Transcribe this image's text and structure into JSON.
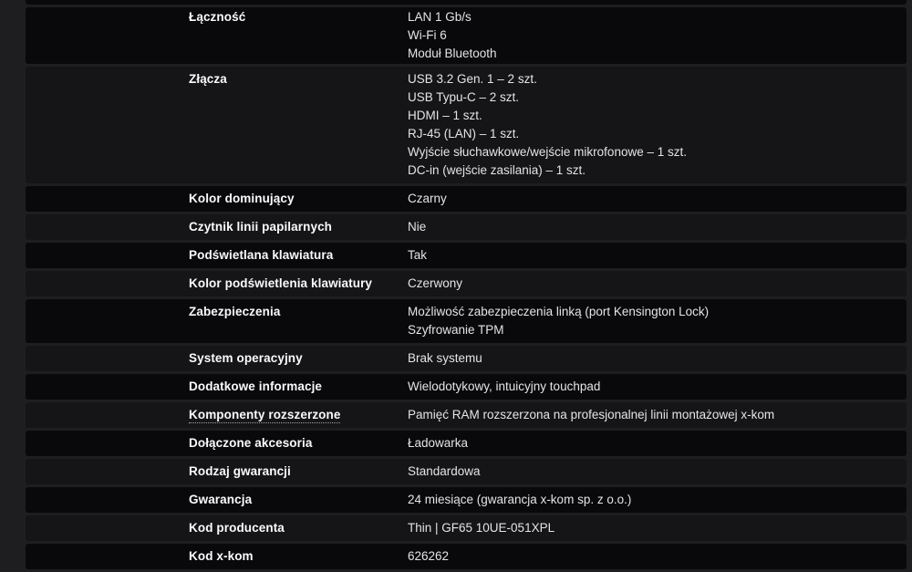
{
  "theme": {
    "page_background": "#1e1e20",
    "row_stripe_light": "#151517",
    "row_stripe_dark": "#09090b",
    "label_color": "#fafafa",
    "value_color": "#e4e4e6"
  },
  "table": {
    "rows": [
      {
        "label": "Łączność",
        "values": [
          "LAN 1 Gb/s",
          "Wi-Fi 6",
          "Moduł Bluetooth"
        ]
      },
      {
        "label": "Złącza",
        "values": [
          "USB 3.2 Gen. 1 – 2 szt.",
          "USB Typu-C – 2 szt.",
          "HDMI – 1 szt.",
          "RJ-45 (LAN) – 1 szt.",
          "Wyjście słuchawkowe/wejście mikrofonowe – 1 szt.",
          "DC-in (wejście zasilania) – 1 szt."
        ]
      },
      {
        "label": "Kolor dominujący",
        "values": [
          "Czarny"
        ]
      },
      {
        "label": "Czytnik linii papilarnych",
        "values": [
          "Nie"
        ]
      },
      {
        "label": "Podświetlana klawiatura",
        "values": [
          "Tak"
        ]
      },
      {
        "label": "Kolor podświetlenia klawiatury",
        "values": [
          "Czerwony"
        ]
      },
      {
        "label": "Zabezpieczenia",
        "values": [
          "Możliwość zabezpieczenia linką (port Kensington Lock)",
          "Szyfrowanie TPM"
        ]
      },
      {
        "label": "System operacyjny",
        "values": [
          "Brak systemu"
        ]
      },
      {
        "label": "Dodatkowe informacje",
        "values": [
          "Wielodotykowy, intuicyjny touchpad"
        ]
      },
      {
        "label": "Komponenty rozszerzone",
        "values": [
          "Pamięć RAM rozszerzona na profesjonalnej linii montażowej x-kom"
        ]
      },
      {
        "label": "Dołączone akcesoria",
        "values": [
          "Ładowarka"
        ]
      },
      {
        "label": "Rodzaj gwarancji",
        "values": [
          "Standardowa"
        ]
      },
      {
        "label": "Gwarancja",
        "values": [
          "24 miesiące (gwarancja x-kom sp. z o.o.)"
        ]
      },
      {
        "label": "Kod producenta",
        "values": [
          "Thin | GF65 10UE-051XPL"
        ]
      },
      {
        "label": "Kod x-kom",
        "values": [
          "626262"
        ]
      }
    ]
  }
}
